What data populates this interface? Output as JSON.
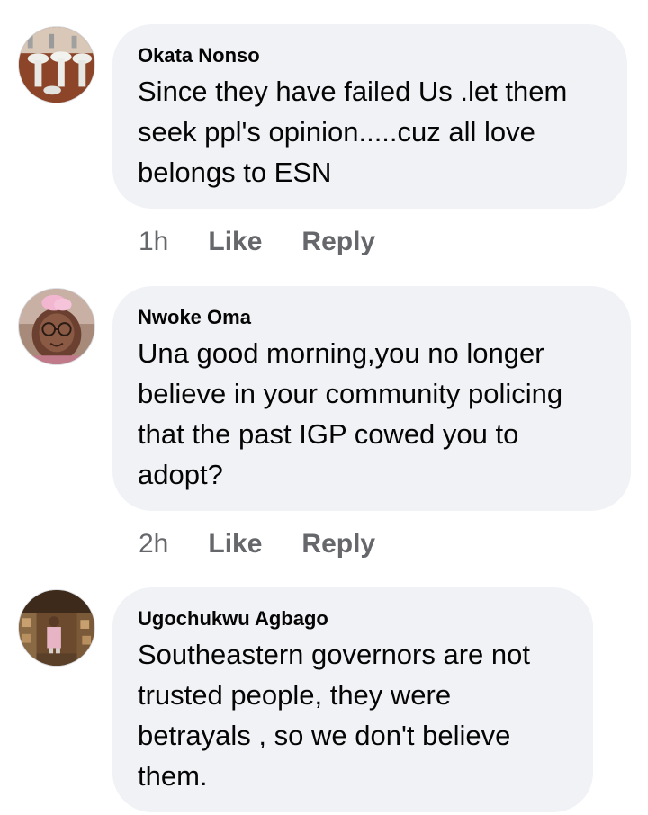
{
  "comments": [
    {
      "author": "Okata Nonso",
      "text": "Since they have failed Us .let them\nseek ppl's opinion.....cuz all love\nbelongs to ESN",
      "time": "1h",
      "like_label": "Like",
      "reply_label": "Reply",
      "avatar_icon": "profile-photo-sinks"
    },
    {
      "author": "Nwoke Oma",
      "text": "Una good morning,you no longer\nbelieve in your community policing\nthat the past IGP cowed you to\nadopt?",
      "time": "2h",
      "like_label": "Like",
      "reply_label": "Reply",
      "avatar_icon": "profile-photo-child-glasses"
    },
    {
      "author": "Ugochukwu Agbago",
      "text": "Southeastern governors are not\ntrusted people, they were\nbetrayals , so we don't believe\nthem."
    }
  ],
  "colors": {
    "bubble_bg": "#f0f2f5",
    "text": "#050505",
    "meta": "#65676b"
  }
}
